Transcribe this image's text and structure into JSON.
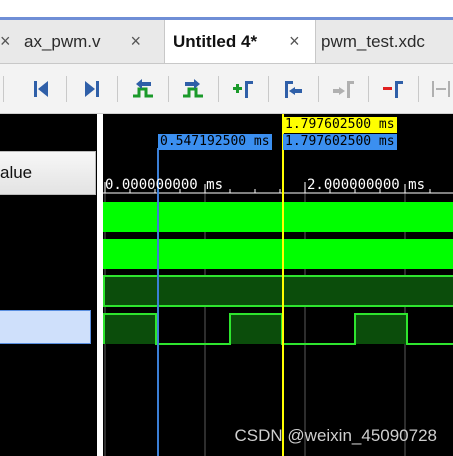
{
  "tabs": [
    {
      "label": "ax_pwm.v",
      "close": "×",
      "active": false
    },
    {
      "label": "Untitled 4*",
      "close": "×",
      "active": true
    },
    {
      "label": "pwm_test.xdc",
      "close": "",
      "active": false
    }
  ],
  "toolbar": {
    "icons": [
      "go-to-start-icon",
      "go-to-end-icon",
      "previous-transition-icon",
      "next-transition-icon",
      "add-marker-icon",
      "go-to-previous-marker-icon",
      "go-to-next-marker-icon",
      "delete-marker-icon",
      "swap-cursors-icon"
    ]
  },
  "names_pane": {
    "header": "alue"
  },
  "waveform": {
    "cursor_time": "1.797602500 ms",
    "marker_time": "0.547192500 ms",
    "delta_time": "1.797602500 ms",
    "time_ticks": [
      "0.000000000 ms",
      "2.000000000 ms"
    ],
    "colors": {
      "signal_high": "#00ff00",
      "bus_fill": "#0b4d0b",
      "cursor": "#ffff00",
      "marker": "#3b7fd6",
      "grid": "#5a5a5a"
    }
  },
  "watermark": "CSDN @weixin_45090728"
}
